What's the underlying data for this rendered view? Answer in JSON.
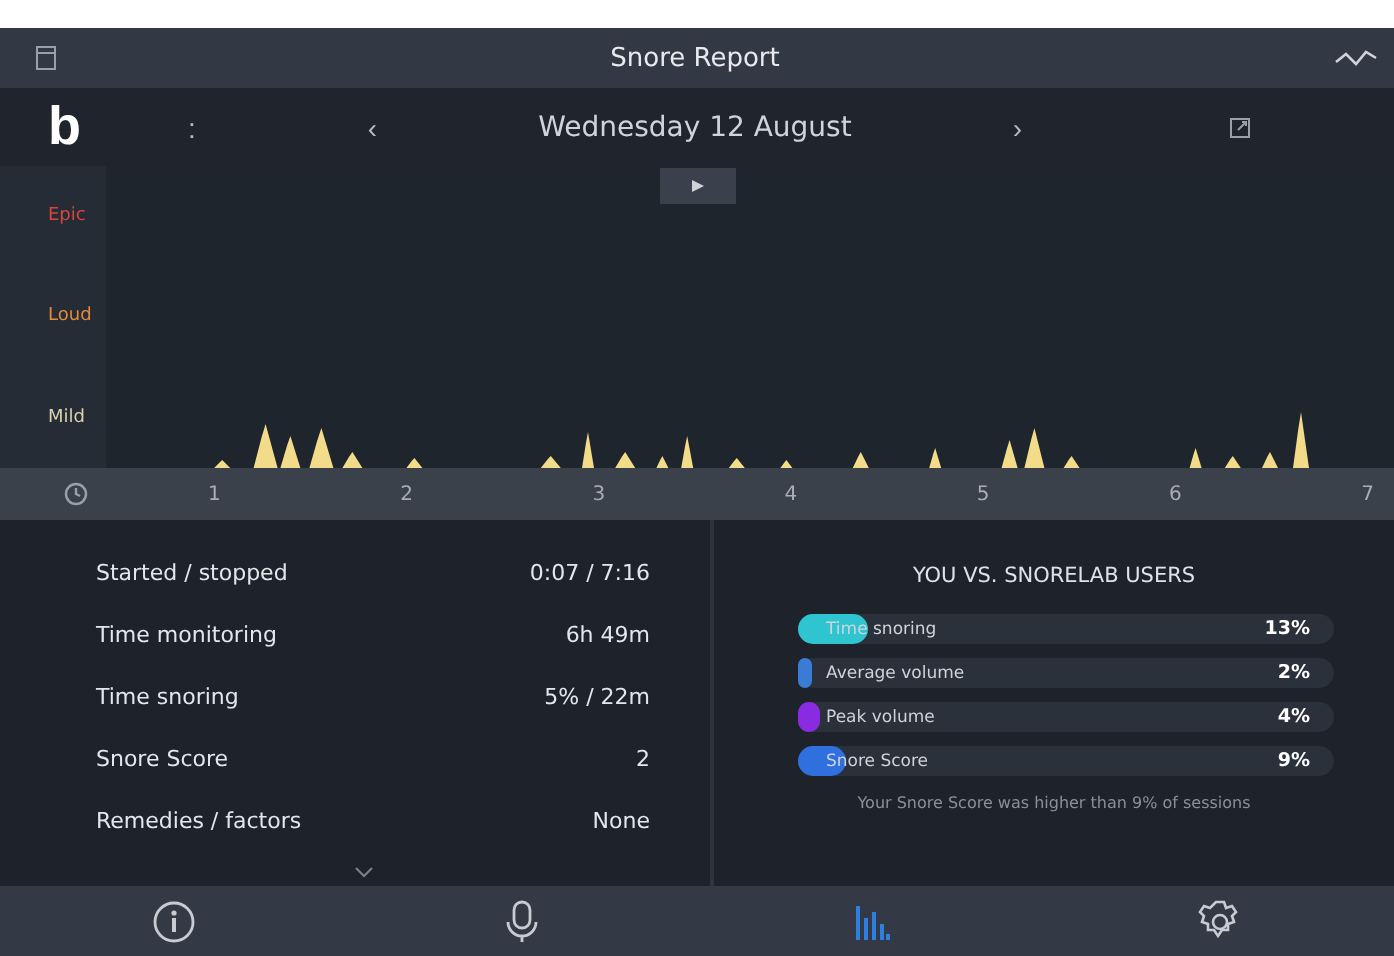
{
  "title_bar": {
    "title": "Snore Report"
  },
  "date_bar": {
    "logo": "b",
    "dots": ":",
    "prev": "‹",
    "date": "Wednesday 12 August",
    "next": "›"
  },
  "chart": {
    "levels": [
      {
        "label": "Epic",
        "color": "#d9453a"
      },
      {
        "label": "Loud",
        "color": "#e08a3a"
      },
      {
        "label": "Mild",
        "color": "#d8d2b0"
      }
    ],
    "hours": [
      "1",
      "2",
      "3",
      "4",
      "5",
      "6",
      "7"
    ]
  },
  "stats": [
    {
      "label": "Started / stopped",
      "value": "0:07 / 7:16"
    },
    {
      "label": "Time monitoring",
      "value": "6h 49m"
    },
    {
      "label": "Time snoring",
      "value": "5% / 22m"
    },
    {
      "label": "Snore Score",
      "value": "2"
    },
    {
      "label": "Remedies / factors",
      "value": "None"
    }
  ],
  "comparison": {
    "title": "YOU VS. SNORELAB USERS",
    "bars": [
      {
        "label": "Time snoring",
        "reading": "13%",
        "level": 0.13,
        "color": "#2ec4d0"
      },
      {
        "label": "Average volume",
        "reading": "2%",
        "level": 0.02,
        "color": "#3a7bd5"
      },
      {
        "label": "Peak volume",
        "reading": "4%",
        "level": 0.04,
        "color": "#8a2be2"
      },
      {
        "label": "Snore Score",
        "reading": "9%",
        "level": 0.09,
        "color": "#2f6fde"
      }
    ],
    "note": "Your Snore Score was higher than  9% of sessions"
  },
  "tabs": [
    {
      "kind": "info",
      "selected": false
    },
    {
      "kind": "record",
      "selected": false
    },
    {
      "kind": "stats",
      "selected": true
    },
    {
      "kind": "settings",
      "selected": false
    }
  ]
}
